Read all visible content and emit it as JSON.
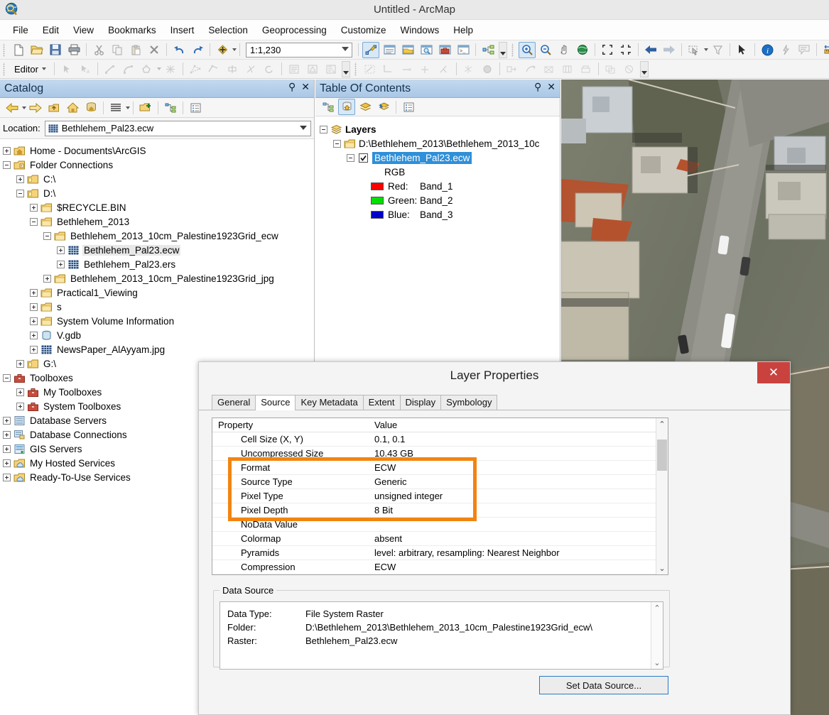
{
  "window": {
    "title": "Untitled - ArcMap",
    "app_icon": "arcmap-globe-icon"
  },
  "menubar": {
    "items": [
      "File",
      "Edit",
      "View",
      "Bookmarks",
      "Insert",
      "Selection",
      "Geoprocessing",
      "Customize",
      "Windows",
      "Help"
    ]
  },
  "standard_toolbar": {
    "scale_value": "1:1,230",
    "buttons": [
      "new-map-icon",
      "open-icon",
      "save-icon",
      "print-icon",
      "cut-icon",
      "copy-icon",
      "paste-icon",
      "delete-icon",
      "undo-icon",
      "redo-icon",
      "add-data-icon",
      "editor-toolbar-icon",
      "table-of-contents-icon",
      "catalog-icon",
      "search-icon",
      "arctoolbox-icon",
      "python-window-icon",
      "model-builder-icon",
      "zoom-in-icon",
      "zoom-out-icon",
      "pan-icon",
      "full-extent-icon",
      "fixed-zoom-in-icon",
      "fixed-zoom-out-icon",
      "back-extent-icon",
      "forward-extent-icon",
      "select-features-icon",
      "clear-selection-icon",
      "select-elements-icon",
      "identify-icon",
      "hyperlink-icon",
      "html-popup-icon",
      "measure-icon",
      "find-icon",
      "find-route-icon",
      "go-to-xy-icon",
      "time-slider-icon",
      "create-viewer-icon"
    ]
  },
  "editor_toolbar": {
    "label": "Editor",
    "buttons": [
      "edit-tool-icon",
      "edit-annotation-icon",
      "straight-segment-icon",
      "arc-segment-icon",
      "construct-tool-icon",
      "point-tool-icon",
      "edit-vertices-icon",
      "reshape-icon",
      "cut-polygons-icon",
      "split-icon",
      "rotate-icon",
      "attributes-icon",
      "sketch-properties-icon",
      "create-features-icon",
      "trace-icon",
      "right-angle-icon",
      "midpoint-icon",
      "distance-icon",
      "intersection-icon",
      "tangent-icon",
      "parcel-icon",
      "replace-geometry-icon",
      "clip-icon",
      "generalize-icon",
      "buffer-icon",
      "merge-icon",
      "union-icon",
      "copy-parallel-icon",
      "explode-icon"
    ]
  },
  "catalog": {
    "title": "Catalog",
    "pin_icon": "pin-icon",
    "close_icon": "close-icon",
    "toolbar_buttons": [
      "back-icon",
      "back-dropdown-icon",
      "forward-icon",
      "up-one-level-icon",
      "home-icon",
      "default-geodatabase-icon",
      "toggle-contents-panel-icon",
      "contents-dropdown-icon",
      "connect-to-folder-icon",
      "toggle-tree-view-icon",
      "organize-items-icon"
    ],
    "location_label": "Location:",
    "location_value": "Bethlehem_Pal23.ecw",
    "location_icon": "raster-icon",
    "tree": [
      {
        "label": "Home - Documents\\ArcGIS",
        "depth": 0,
        "expander": "plus",
        "icon": "home-folder-icon"
      },
      {
        "label": "Folder Connections",
        "depth": 0,
        "expander": "minus",
        "icon": "folder-connections-icon"
      },
      {
        "label": "C:\\",
        "depth": 1,
        "expander": "plus",
        "icon": "folder-connection-icon"
      },
      {
        "label": "D:\\",
        "depth": 1,
        "expander": "minus",
        "icon": "folder-connection-icon"
      },
      {
        "label": "$RECYCLE.BIN",
        "depth": 2,
        "expander": "plus",
        "icon": "folder-icon"
      },
      {
        "label": "Bethlehem_2013",
        "depth": 2,
        "expander": "minus",
        "icon": "folder-icon"
      },
      {
        "label": "Bethlehem_2013_10cm_Palestine1923Grid_ecw",
        "depth": 3,
        "expander": "minus",
        "icon": "folder-icon"
      },
      {
        "label": "Bethlehem_Pal23.ecw",
        "depth": 4,
        "expander": "plus",
        "icon": "raster-icon",
        "selected": true
      },
      {
        "label": "Bethlehem_Pal23.ers",
        "depth": 4,
        "expander": "plus",
        "icon": "raster-icon"
      },
      {
        "label": "Bethlehem_2013_10cm_Palestine1923Grid_jpg",
        "depth": 3,
        "expander": "plus",
        "icon": "folder-icon"
      },
      {
        "label": "Practical1_Viewing",
        "depth": 2,
        "expander": "plus",
        "icon": "folder-icon"
      },
      {
        "label": "s",
        "depth": 2,
        "expander": "plus",
        "icon": "folder-icon"
      },
      {
        "label": "System Volume Information",
        "depth": 2,
        "expander": "plus",
        "icon": "folder-icon"
      },
      {
        "label": "V.gdb",
        "depth": 2,
        "expander": "plus",
        "icon": "geodatabase-icon"
      },
      {
        "label": "NewsPaper_AlAyyam.jpg",
        "depth": 2,
        "expander": "plus",
        "icon": "raster-icon"
      },
      {
        "label": "G:\\",
        "depth": 1,
        "expander": "plus",
        "icon": "folder-connection-icon"
      },
      {
        "label": "Toolboxes",
        "depth": 0,
        "expander": "minus",
        "icon": "toolbox-icon"
      },
      {
        "label": "My Toolboxes",
        "depth": 1,
        "expander": "plus",
        "icon": "toolbox-icon"
      },
      {
        "label": "System Toolboxes",
        "depth": 1,
        "expander": "plus",
        "icon": "toolbox-icon"
      },
      {
        "label": "Database Servers",
        "depth": 0,
        "expander": "plus",
        "icon": "database-server-icon"
      },
      {
        "label": "Database Connections",
        "depth": 0,
        "expander": "plus",
        "icon": "database-connection-icon"
      },
      {
        "label": "GIS Servers",
        "depth": 0,
        "expander": "plus",
        "icon": "gis-server-icon"
      },
      {
        "label": "My Hosted Services",
        "depth": 0,
        "expander": "plus",
        "icon": "cloud-services-icon"
      },
      {
        "label": "Ready-To-Use Services",
        "depth": 0,
        "expander": "plus",
        "icon": "cloud-services-icon"
      }
    ]
  },
  "table_of_contents": {
    "title": "Table Of Contents",
    "pin_icon": "pin-icon",
    "close_icon": "close-icon",
    "toolbar_buttons": [
      "list-by-drawing-order-icon",
      "list-by-source-icon",
      "list-by-visibility-icon",
      "list-by-selection-icon",
      "options-icon"
    ],
    "active_toolbar_button": "list-by-source-icon",
    "tree": [
      {
        "label": "Layers",
        "depth": 0,
        "expander": "minus",
        "icon": "layers-icon",
        "bold": true
      },
      {
        "label": "D:\\Bethlehem_2013\\Bethlehem_2013_10c",
        "depth": 1,
        "expander": "minus",
        "icon": "folder-icon"
      },
      {
        "label": "Bethlehem_Pal23.ecw",
        "depth": 2,
        "expander": "minus",
        "icon": "checkbox-checked-icon",
        "selected": true
      },
      {
        "label": "RGB",
        "depth": 4,
        "expander": "none",
        "icon": "none"
      }
    ],
    "bands": [
      {
        "name": "Red:",
        "band": "Band_1",
        "swatch": "#ff0000"
      },
      {
        "name": "Green:",
        "band": "Band_2",
        "swatch": "#00e000"
      },
      {
        "name": "Blue:",
        "band": "Band_3",
        "swatch": "#0000cc"
      }
    ]
  },
  "layer_properties": {
    "title": "Layer Properties",
    "close_label": "✕",
    "tabs": [
      "General",
      "Source",
      "Key Metadata",
      "Extent",
      "Display",
      "Symbology"
    ],
    "active_tab": "Source",
    "property_table": {
      "columns": [
        "Property",
        "Value"
      ],
      "rows": [
        {
          "property": "Cell Size (X, Y)",
          "value": "0.1, 0.1"
        },
        {
          "property": "Uncompressed Size",
          "value": "10.43 GB"
        },
        {
          "property": "Format",
          "value": "ECW"
        },
        {
          "property": "Source Type",
          "value": "Generic"
        },
        {
          "property": "Pixel Type",
          "value": "unsigned integer"
        },
        {
          "property": "Pixel Depth",
          "value": "8 Bit"
        },
        {
          "property": "NoData Value",
          "value": ""
        },
        {
          "property": "Colormap",
          "value": "absent"
        },
        {
          "property": "Pyramids",
          "value": "level: arbitrary, resampling: Nearest Neighbor"
        },
        {
          "property": "Compression",
          "value": "ECW"
        }
      ],
      "highlight_color": "#f28411",
      "highlight_rows": [
        "Format",
        "Source Type",
        "Pixel Type",
        "Pixel Depth"
      ]
    },
    "data_source": {
      "legend": "Data Source",
      "lines": [
        {
          "key": "Data Type:",
          "value": "File System Raster"
        },
        {
          "key": "Folder:",
          "value": "D:\\Bethlehem_2013\\Bethlehem_2013_10cm_Palestine1923Grid_ecw\\"
        },
        {
          "key": "Raster:",
          "value": "Bethlehem_Pal23.ecw"
        }
      ]
    },
    "set_data_source_button": "Set Data Source..."
  }
}
